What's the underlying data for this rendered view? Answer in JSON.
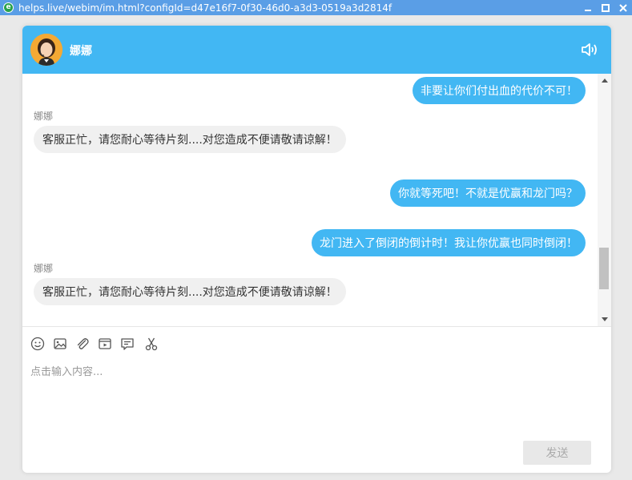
{
  "window": {
    "title_url": "helps.live/webim/im.html?configId=d47e16f7-0f30-46d0-a3d3-0519a3d2814f"
  },
  "header": {
    "agent_name": "娜娜"
  },
  "messages": [
    {
      "side": "right",
      "text": "非要让你们付出血的代价不可！"
    },
    {
      "side": "left",
      "sender": "娜娜",
      "text": "客服正忙，请您耐心等待片刻....对您造成不便请敬请谅解！"
    },
    {
      "side": "right",
      "text": "你就等死吧！不就是优赢和龙门吗？"
    },
    {
      "side": "right",
      "text": "龙门进入了倒闭的倒计时！我让你优赢也同时倒闭！"
    },
    {
      "side": "left",
      "sender": "娜娜",
      "text": "客服正忙，请您耐心等待片刻....对您造成不便请敬请谅解！"
    }
  ],
  "toolbar": {
    "icons": [
      "emoji-icon",
      "image-icon",
      "attachment-icon",
      "video-icon",
      "form-icon",
      "screenshot-scissors-icon"
    ]
  },
  "composer": {
    "placeholder": "点击输入内容...",
    "value": ""
  },
  "send_label": "发送",
  "colors": {
    "accent": "#42b7f3",
    "titlebar": "#5a9ee6",
    "bubble_left": "#f0f0f0"
  }
}
